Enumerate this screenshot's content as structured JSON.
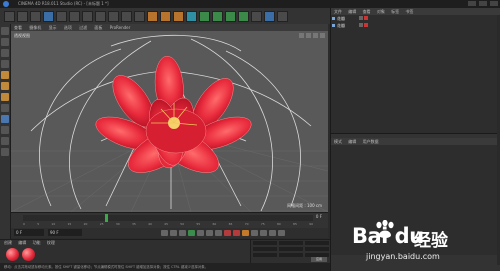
{
  "window": {
    "title": "CINEMA 4D R18.011 Studio (RC) - [未标题 1 *]"
  },
  "viewport": {
    "menu": [
      "查看",
      "摄像机",
      "显示",
      "选项",
      "过滤",
      "面板",
      "ProRender"
    ],
    "label": "透视视图",
    "grid_scale": "网格间距 : 100 cm"
  },
  "timeline": {
    "ticks": [
      "0",
      "5",
      "10",
      "15",
      "20",
      "25",
      "30",
      "35",
      "40",
      "45",
      "50",
      "55",
      "60",
      "65",
      "70",
      "75",
      "80",
      "85",
      "90"
    ],
    "end_frame": "0 F"
  },
  "transport": {
    "start_field": "0 F",
    "end_field": "90 F"
  },
  "material_panel": {
    "menu": [
      "创建",
      "编辑",
      "功能",
      "纹理"
    ]
  },
  "coords": {
    "apply_label": "应用"
  },
  "status_bar": {
    "text": "移动：点击并拖动鼠标移动元素。按住 SHIFT 键量化移动；节点编辑模式时按住 SHIFT 键增加选择对象；按住 CTRL 键减少选择对象。"
  },
  "object_manager": {
    "menu": [
      "文件",
      "编辑",
      "查看",
      "对象",
      "标签",
      "书签"
    ],
    "objects": [
      {
        "name": "花瓣",
        "tags": [
          "gray",
          "red"
        ]
      },
      {
        "name": "花瓣",
        "tags": [
          "gray",
          "red"
        ]
      }
    ]
  },
  "attribute_manager": {
    "menu": [
      "模式",
      "编辑",
      "用户数据"
    ]
  },
  "watermark": {
    "brand": "Bai du",
    "product": "经验",
    "url": "jingyan.baidu.com"
  },
  "colors": {
    "petal": "#e82a3c",
    "viewport_bg": "#595959",
    "accent_green": "#3ca84a"
  }
}
